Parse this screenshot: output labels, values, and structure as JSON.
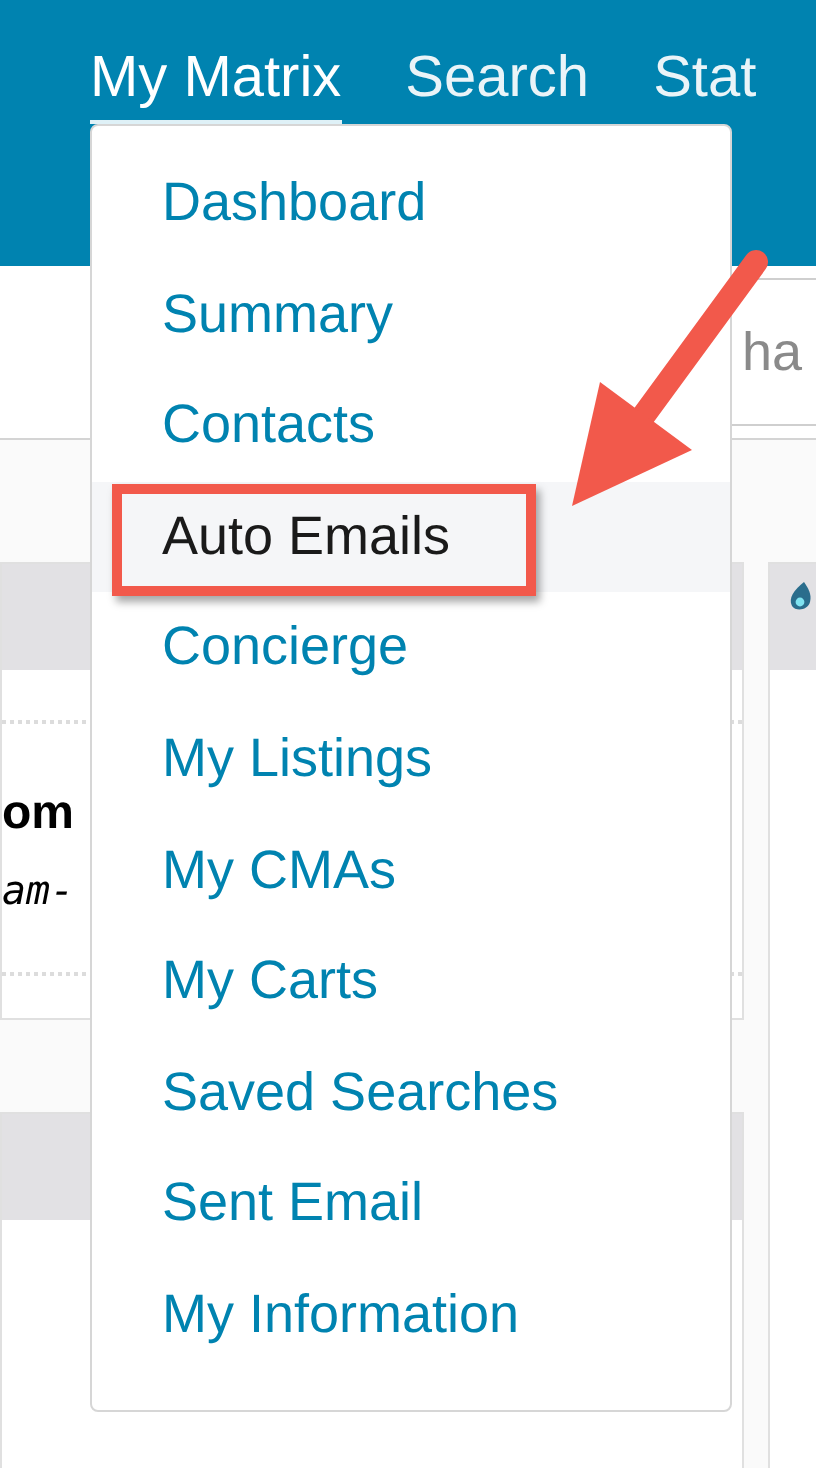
{
  "nav": [
    {
      "label": "My Matrix",
      "selected": true
    },
    {
      "label": "Search",
      "selected": false
    },
    {
      "label": "Stat",
      "selected": false
    }
  ],
  "search": {
    "placeholder": "ha"
  },
  "card": {
    "title_line": "om",
    "subtitle_line": "am-"
  },
  "menu": [
    {
      "label": "Dashboard",
      "selected": false
    },
    {
      "label": "Summary",
      "selected": false
    },
    {
      "label": "Contacts",
      "selected": false
    },
    {
      "label": "Auto Emails",
      "selected": true
    },
    {
      "label": "Concierge",
      "selected": false
    },
    {
      "label": "My Listings",
      "selected": false
    },
    {
      "label": "My CMAs",
      "selected": false
    },
    {
      "label": "My Carts",
      "selected": false
    },
    {
      "label": "Saved Searches",
      "selected": false
    },
    {
      "label": "Sent Email",
      "selected": false
    },
    {
      "label": "My Information",
      "selected": false
    }
  ]
}
